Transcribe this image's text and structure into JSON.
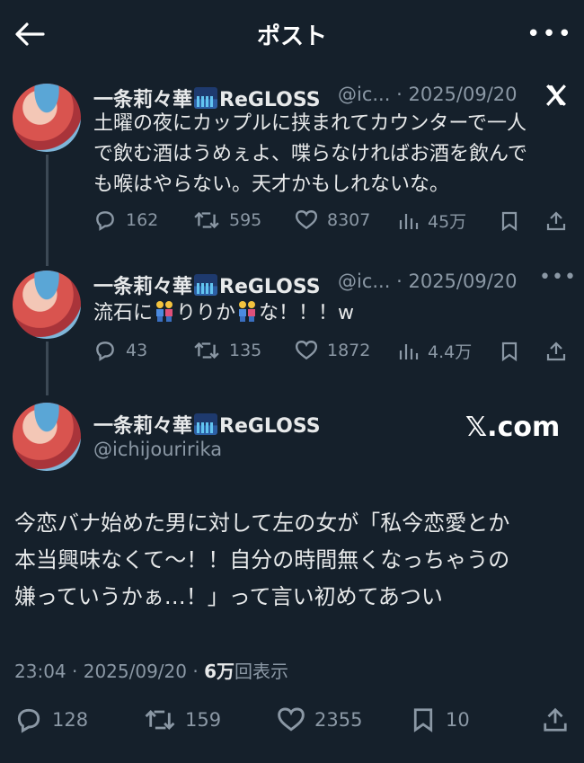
{
  "header": {
    "title": "ポスト"
  },
  "tweets": [
    {
      "name_prefix": "一条莉々華",
      "name_suffix": "ReGLOSS",
      "handle": "@ic...",
      "sep": "·",
      "date": "2025/09/20",
      "text_lines": [
        "土曜の夜にカップルに挟まれてカウンターで一人",
        "で飲む酒はうめぇよ、喋らなければお酒を飲んで",
        "も喉はやらない。天才かもしれないな。"
      ],
      "replies": "162",
      "reposts": "595",
      "likes": "8307",
      "views": "45万"
    },
    {
      "name_prefix": "一条莉々華",
      "name_suffix": "ReGLOSS",
      "handle": "@ic...",
      "sep": "·",
      "date": "2025/09/20",
      "text_a": "流石に",
      "text_b": "りりか",
      "text_c": "な！！！w",
      "replies": "43",
      "reposts": "135",
      "likes": "1872",
      "views": "4.4万"
    }
  ],
  "main": {
    "name_prefix": "一条莉々華",
    "name_suffix": "ReGLOSS",
    "handle": "@ichijouririka",
    "brand": "𝕏.com",
    "text_lines": [
      "今恋バナ始めた男に対して左の女が「私今恋愛とか",
      "本当興味なくて〜！！自分の時間無くなっちゃうの",
      "嫌っていうかぁ…！」って言い初めてあつい"
    ],
    "time": "23:04",
    "sep": "·",
    "date": "2025/09/20",
    "sep2": "·",
    "views_count": "6万",
    "views_label": "回表示",
    "replies": "128",
    "reposts": "159",
    "likes": "2355",
    "bookmarks": "10"
  },
  "colors": {
    "background": "#15202b",
    "text": "#e7e9ea",
    "muted": "#8b98a5",
    "thread_line": "#3c4955"
  },
  "icons": [
    "back-arrow-icon",
    "more-icon",
    "x-logo-icon",
    "reply-icon",
    "repost-icon",
    "like-icon",
    "views-icon",
    "bookmark-icon",
    "share-icon",
    "couple-emoji",
    "cityscape-emoji"
  ]
}
